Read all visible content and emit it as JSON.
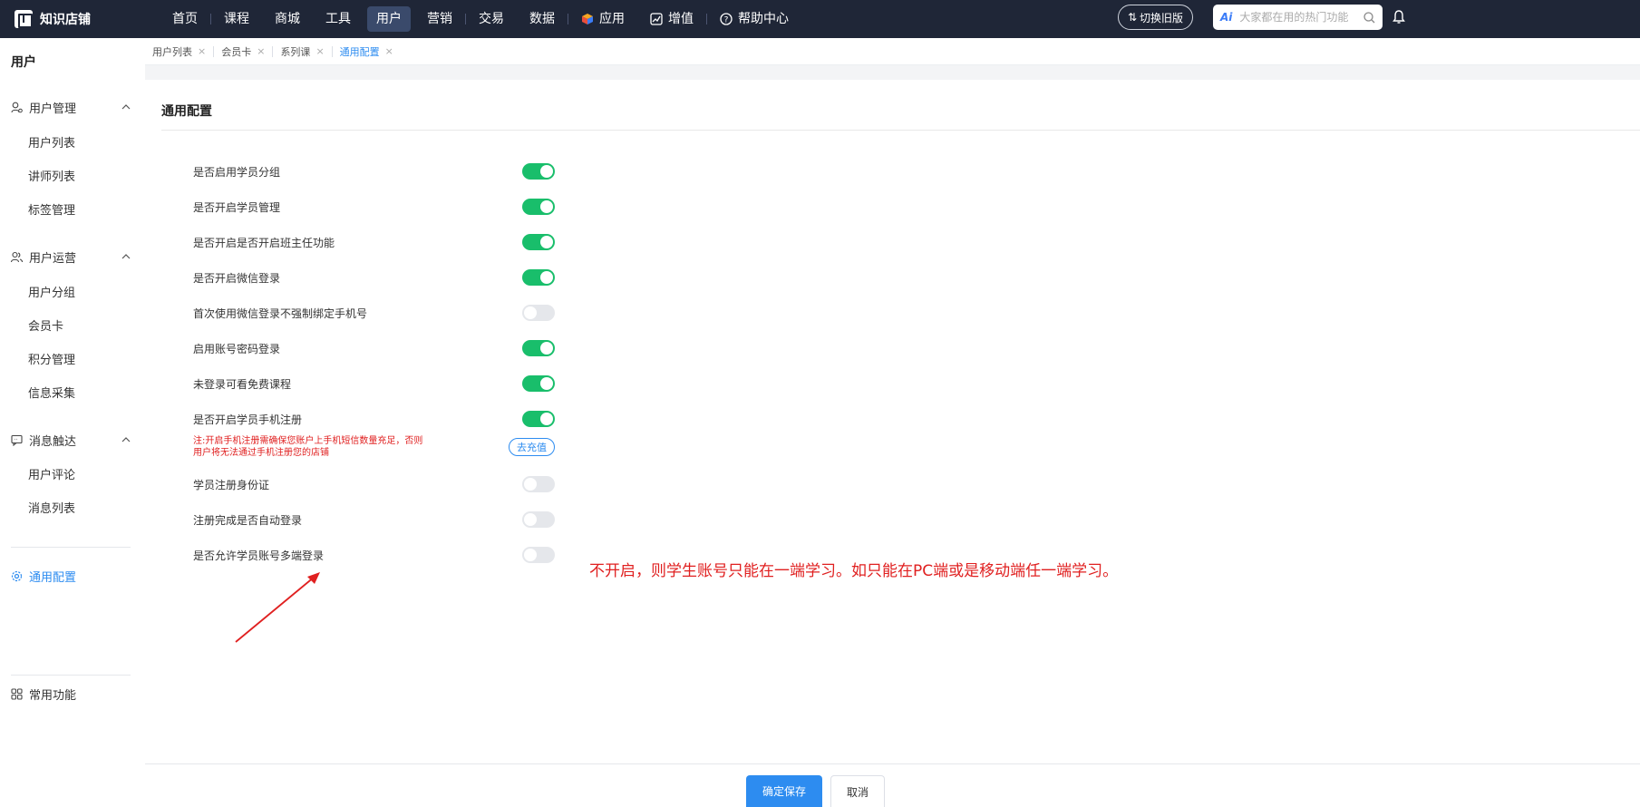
{
  "app": {
    "name": "知识店铺"
  },
  "topnav": {
    "items": [
      {
        "label": "首页"
      },
      {
        "label": "课程"
      },
      {
        "label": "商城"
      },
      {
        "label": "工具"
      },
      {
        "label": "用户",
        "active": true
      },
      {
        "label": "营销"
      },
      {
        "label": "交易"
      },
      {
        "label": "数据"
      },
      {
        "label": "应用",
        "icon": "cube-icon"
      },
      {
        "label": "增值",
        "icon": "chart-icon"
      },
      {
        "label": "帮助中心",
        "icon": "help-icon"
      }
    ],
    "switch_old": "切换旧版",
    "search_ai": "Ai",
    "search_placeholder": "大家都在用的热门功能"
  },
  "sidebar": {
    "title": "用户",
    "groups": [
      {
        "label": "用户管理",
        "icon": "user-manage-icon",
        "items": [
          "用户列表",
          "讲师列表",
          "标签管理"
        ]
      },
      {
        "label": "用户运营",
        "icon": "users-icon",
        "items": [
          "用户分组",
          "会员卡",
          "积分管理",
          "信息采集"
        ]
      },
      {
        "label": "消息触达",
        "icon": "message-icon",
        "items": [
          "用户评论",
          "消息列表"
        ]
      }
    ],
    "active_item": "通用配置",
    "bottom_item": "常用功能"
  },
  "tabs": [
    {
      "label": "用户列表"
    },
    {
      "label": "会员卡"
    },
    {
      "label": "系列课"
    },
    {
      "label": "通用配置",
      "active": true
    }
  ],
  "main": {
    "title": "通用配置",
    "settings": [
      {
        "label": "是否启用学员分组",
        "on": true
      },
      {
        "label": "是否开启学员管理",
        "on": true
      },
      {
        "label": "是否开启是否开启班主任功能",
        "on": true
      },
      {
        "label": "是否开启微信登录",
        "on": true
      },
      {
        "label": "首次使用微信登录不强制绑定手机号",
        "on": false
      },
      {
        "label": "启用账号密码登录",
        "on": true
      },
      {
        "label": "未登录可看免费课程",
        "on": true
      },
      {
        "label": "是否开启学员手机注册",
        "on": true
      },
      {
        "label": "学员注册身份证",
        "on": false
      },
      {
        "label": "注册完成是否自动登录",
        "on": false
      },
      {
        "label": "是否允许学员账号多端登录",
        "on": false
      }
    ],
    "sms_note": "注:开启手机注册需确保您账户上手机短信数量充足，否则用户将无法通过手机注册您的店铺",
    "recharge_label": "去充值",
    "annotation": "不开启，则学生账号只能在一端学习。如只能在PC端或是移动端任一端学习。"
  },
  "footer": {
    "save_label": "确定保存",
    "cancel_label": "取消"
  },
  "colors": {
    "topbar": "#1f2637",
    "accent": "#2d8cf0",
    "toggle_on": "#19be6b",
    "annotation": "#e02020"
  }
}
